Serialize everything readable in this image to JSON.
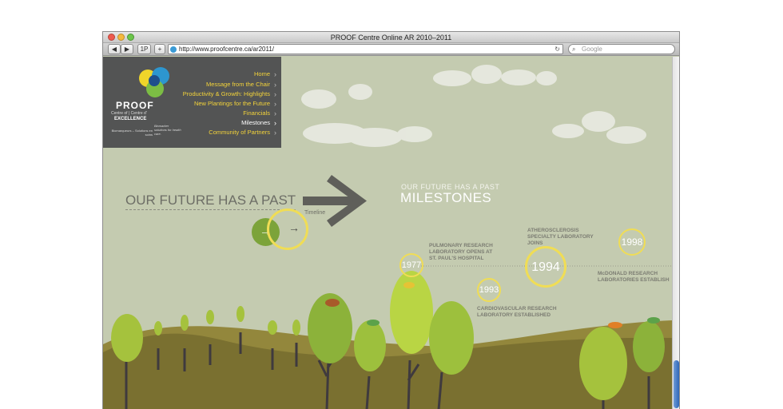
{
  "browser": {
    "title": "PROOF Centre Online AR 2010–2011",
    "url": "http://www.proofcentre.ca/ar2011/",
    "search_placeholder": "Google",
    "bookmarks_label": "1P",
    "add_label": "+"
  },
  "logo": {
    "name": "PROOF",
    "line1": "Centre of | Centre d'",
    "line2": "EXCELLENCE",
    "tag1": "Biomarker solutions for health care.",
    "tag2": "Biomarqueurs – Solutions en soins"
  },
  "nav": {
    "items": [
      {
        "label": "Home",
        "active": false
      },
      {
        "label": "Message from the Chair",
        "active": false
      },
      {
        "label": "Productivity & Growth: Highlights",
        "active": false
      },
      {
        "label": "New Plantings for the Future",
        "active": false
      },
      {
        "label": "Financials",
        "active": false
      },
      {
        "label": "Milestones",
        "active": true
      },
      {
        "label": "Community of Partners",
        "active": false
      }
    ]
  },
  "hero": {
    "tagline": "OUR FUTURE HAS A PAST",
    "timeline_label": "Timeline",
    "small_heading": "OUR FUTURE HAS A PAST",
    "big_heading": "MILESTONES"
  },
  "milestones": [
    {
      "year": "1977",
      "label": "PULMONARY RESEARCH LABORATORY OPENS AT ST. PAUL'S HOSPITAL"
    },
    {
      "year": "1993",
      "label": "CARDIOVASCULAR RESEARCH LABORATORY ESTABLISHED"
    },
    {
      "year": "1994",
      "label": "ATHEROSCLEROSIS SPECIALTY LABORATORY JOINS"
    },
    {
      "year": "1998",
      "label": "McDONALD RESEARCH LABORATORIES ESTABLISH"
    }
  ],
  "colors": {
    "sky": "#c4cbb0",
    "hill": "#7a7030",
    "tree": "#9cbf3a",
    "accent_yellow": "#f0dd55",
    "nav_bg": "#535454",
    "nav_text": "#f3d33a"
  }
}
